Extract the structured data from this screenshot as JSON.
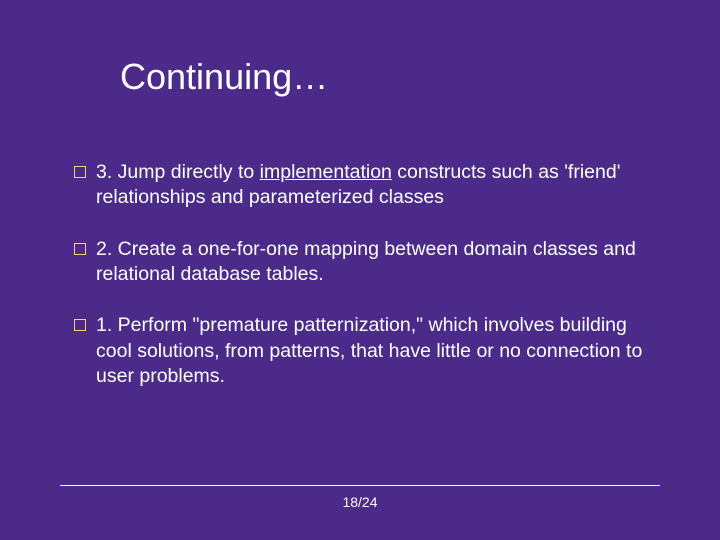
{
  "title": "Continuing…",
  "bullets": [
    {
      "prefix": "3.  Jump directly to ",
      "underlined": "implementation",
      "suffix": " constructs such as 'friend' relationships and parameterized classes"
    },
    {
      "prefix": "2.  Create a one-for-one mapping between domain classes and relational database tables.",
      "underlined": "",
      "suffix": ""
    },
    {
      "prefix": "1.  Perform \"premature patternization,\" which involves building cool solutions, from patterns, that have little or no connection to user problems.",
      "underlined": "",
      "suffix": ""
    }
  ],
  "page": "18/24"
}
